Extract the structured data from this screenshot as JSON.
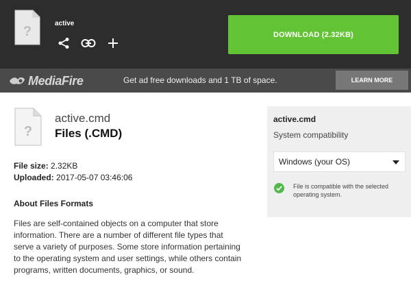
{
  "header": {
    "filename": "active",
    "download_label": "DOWNLOAD (2.32KB)",
    "actions": [
      "share-icon",
      "link-icon",
      "plus-icon"
    ]
  },
  "promo": {
    "brand": "MediaFire",
    "message": "Get ad free downloads and 1 TB of space.",
    "learn_more": "LEARN MORE"
  },
  "file": {
    "name": "active.cmd",
    "type": "Files (.CMD)",
    "size_label": "File size:",
    "size_value": "2.32KB",
    "uploaded_label": "Uploaded:",
    "uploaded_value": "2017-05-07 03:46:06"
  },
  "about": {
    "title": "About Files Formats",
    "text": "Files are self-contained objects on a computer that store information. There are a number of different file types that serve a variety of purposes. Some store information pertaining to the operating system and user settings, while others contain programs, written documents, graphics, or sound."
  },
  "sidebar": {
    "filename": "active.cmd",
    "compat_title": "System compatibility",
    "os_selected": "Windows (your OS)",
    "compat_message": "File is compatible with the selected operating system."
  },
  "colors": {
    "header_bg": "#2d2d2d",
    "download_green": "#62c435",
    "promo_bg": "#4a4a4a",
    "sidebar_bg": "#efefef",
    "check_green": "#52b84a"
  }
}
